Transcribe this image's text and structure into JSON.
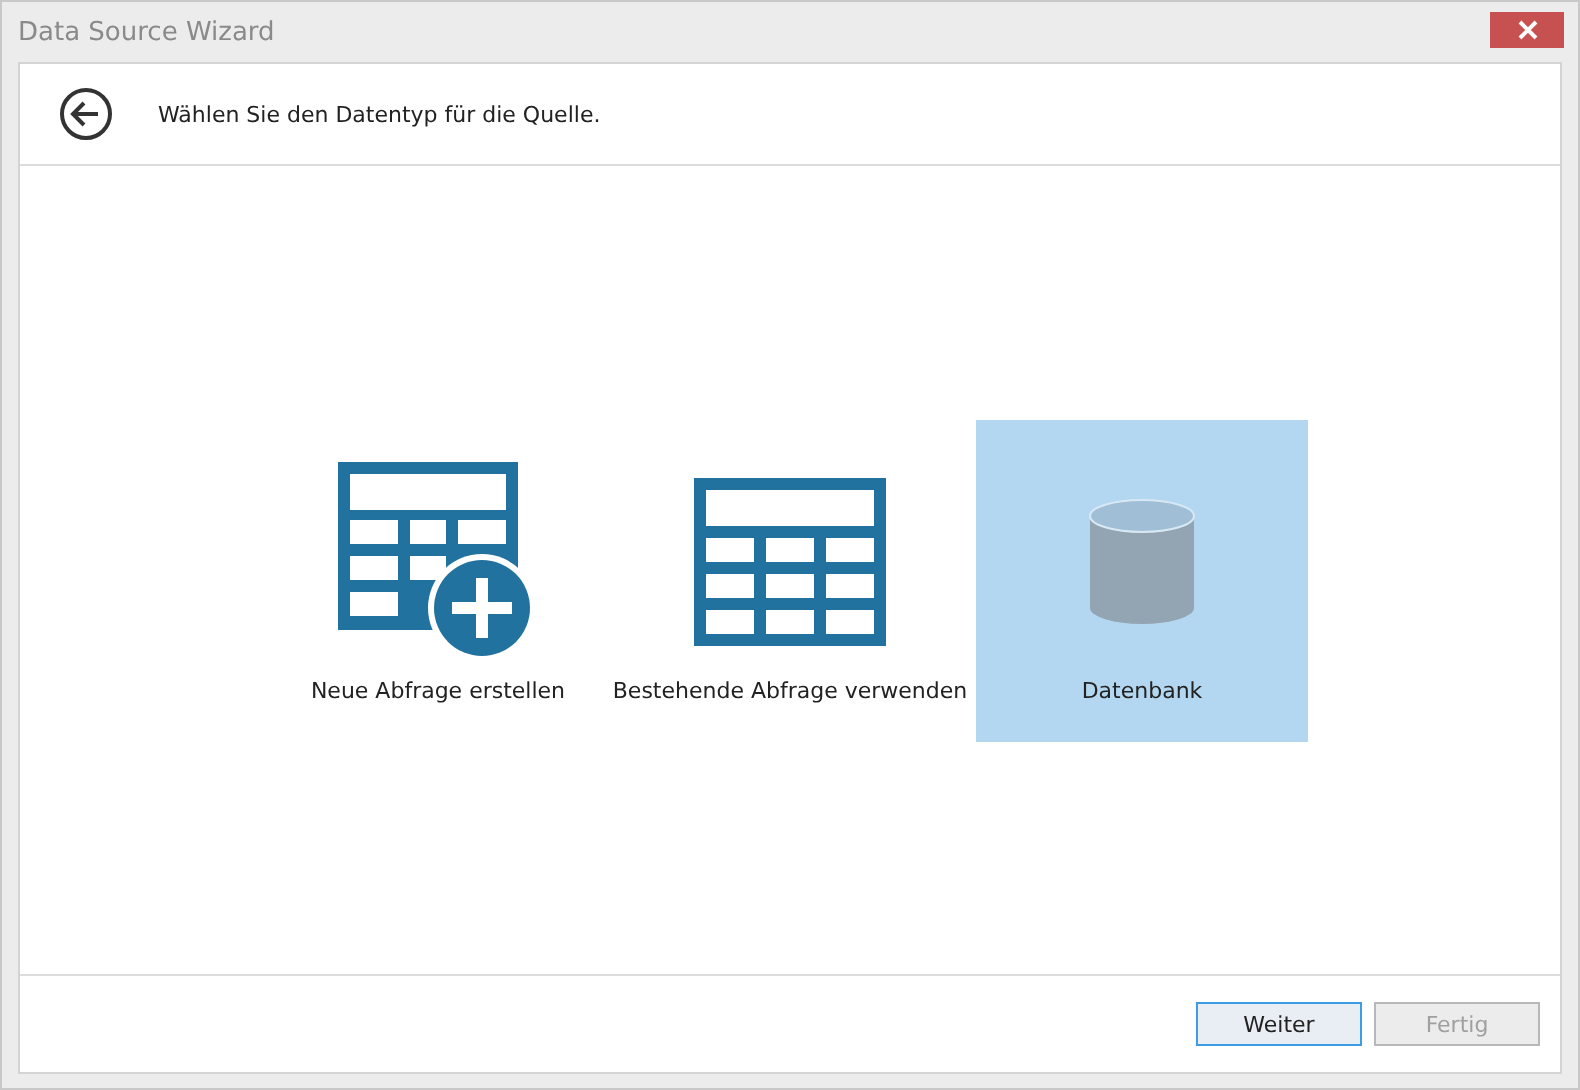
{
  "window": {
    "title": "Data Source Wizard"
  },
  "header": {
    "text": "Wählen Sie den Datentyp für die Quelle."
  },
  "options": [
    {
      "kind": "new-query",
      "label": "Neue Abfrage erstellen",
      "selected": false
    },
    {
      "kind": "existing-query",
      "label": "Bestehende Abfrage verwenden",
      "selected": false
    },
    {
      "kind": "database",
      "label": "Datenbank",
      "selected": true
    }
  ],
  "buttons": [
    {
      "label": "Weiter",
      "disabled": false,
      "focused": true
    },
    {
      "label": "Fertig",
      "disabled": true,
      "focused": false
    }
  ]
}
